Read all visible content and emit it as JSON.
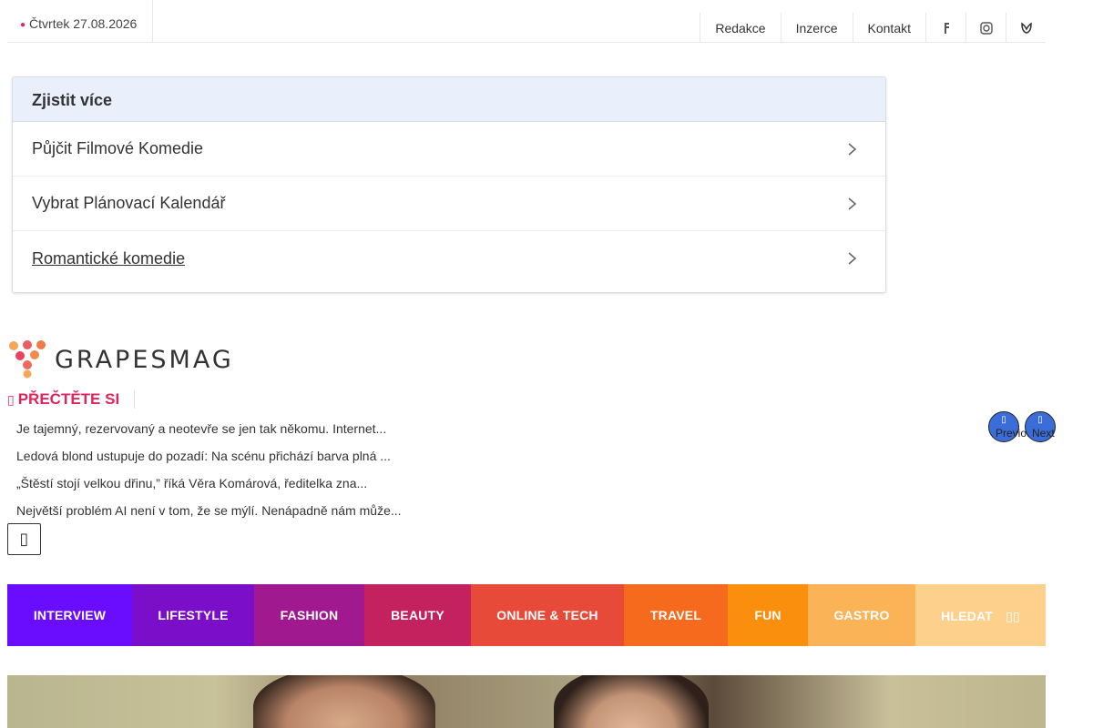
{
  "topbar": {
    "date": "Čtvrtek 27.08.2026",
    "links": [
      "Redakce",
      "Inzerce",
      "Kontakt"
    ],
    "icons": [
      "facebook-icon",
      "instagram-icon",
      "social-icon"
    ]
  },
  "learn_more": {
    "title": "Zjistit více",
    "items": [
      {
        "label": "Půjčit Filmové Komedie"
      },
      {
        "label": "Vybrat Plánovací Kalendář"
      },
      {
        "label": "Romantické komedie"
      }
    ]
  },
  "logo": {
    "text": "GRAPESMAG"
  },
  "read_also": {
    "title": "PŘEČTĚTE SI",
    "items": [
      "Je tajemný, rezervovaný a neotevře se jen tak někomu. Internet...",
      "Ledová blond ustupuje do pozadí: Na scénu přichází barva plná ...",
      "„Štěstí stojí velkou dřinu,” říká Věra Komárová, ředitelka zna...",
      "Největší problém AI není v tom, že se mýlí. Nenápadně nám může..."
    ],
    "prev_label": "Previous",
    "next_label": "Next"
  },
  "categories": [
    {
      "label": "INTERVIEW",
      "color": "#6a0dff"
    },
    {
      "label": "LIFESTYLE",
      "color": "#7b0fc9"
    },
    {
      "label": "FASHION",
      "color": "#a0198f"
    },
    {
      "label": "BEAUTY",
      "color": "#c4225f"
    },
    {
      "label": "ONLINE & TECH",
      "color": "#e84a3a"
    },
    {
      "label": "TRAVEL",
      "color": "#f66a1e"
    },
    {
      "label": "FUN",
      "color": "#f98f0d"
    },
    {
      "label": "GASTRO",
      "color": "#fbb358"
    },
    {
      "label": "HLEDAT",
      "color": "#fdd08c"
    }
  ],
  "colors": {
    "accent": "#e0245e",
    "nav_button": "#3b6dd8"
  }
}
